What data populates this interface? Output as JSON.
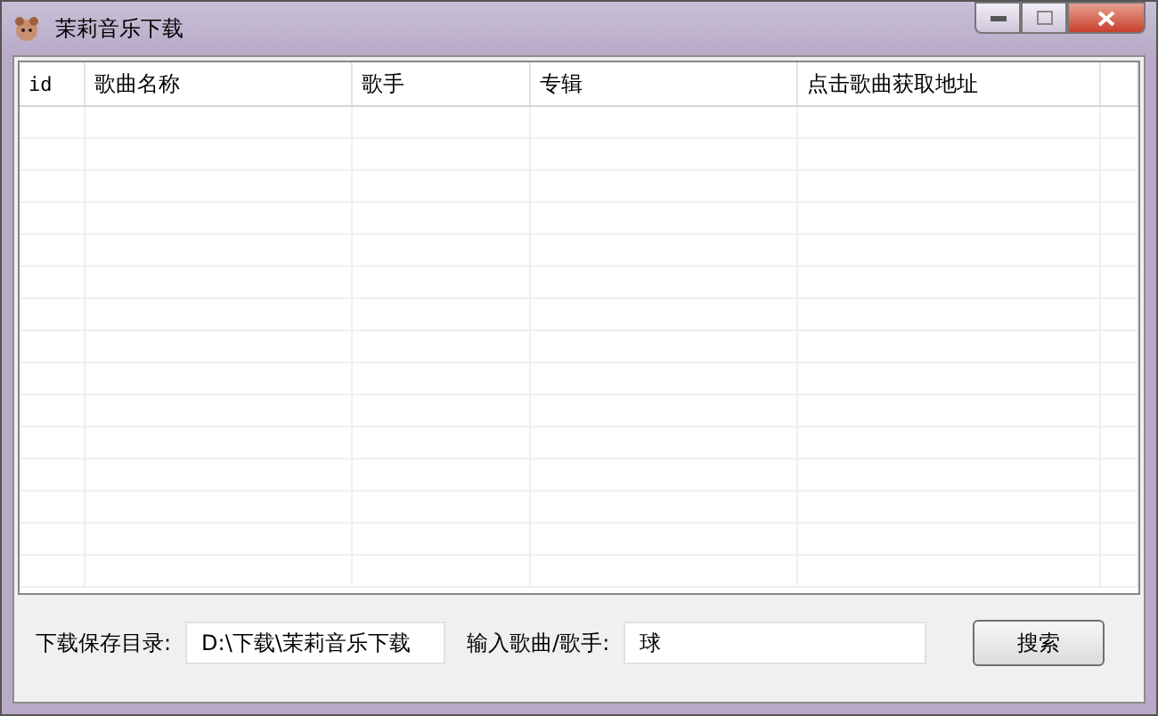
{
  "window": {
    "title": "茉莉音乐下载"
  },
  "table": {
    "columns": [
      "id",
      "歌曲名称",
      "歌手",
      "专辑",
      "点击歌曲获取地址"
    ]
  },
  "save_dir": {
    "label": "下载保存目录:",
    "value": "D:\\下载\\茉莉音乐下载"
  },
  "search": {
    "label": "输入歌曲/歌手:",
    "value": "球",
    "button": "搜索"
  }
}
